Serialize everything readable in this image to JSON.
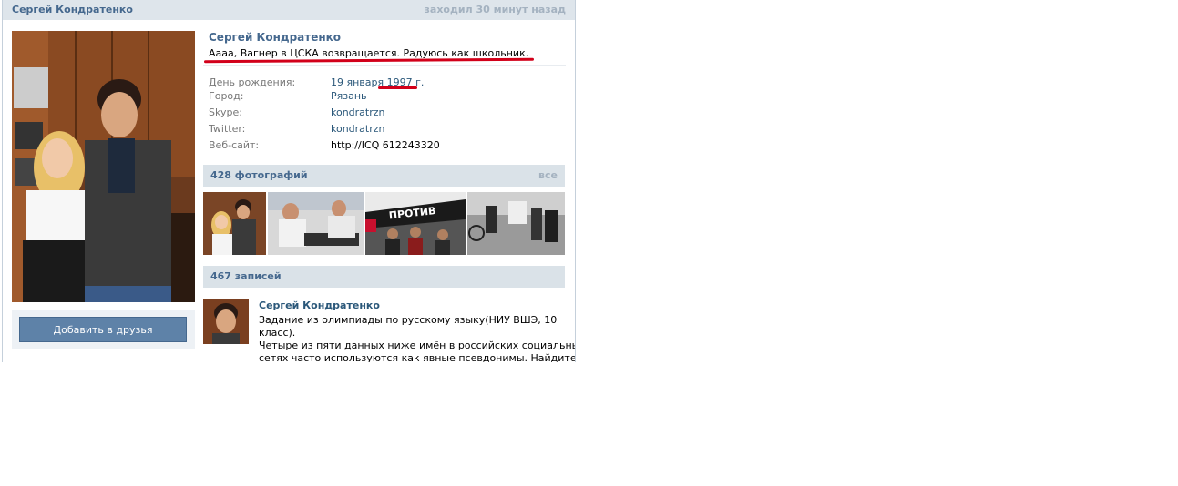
{
  "header": {
    "name": "Сергей Кондратенко",
    "last_seen": "заходил 30 минут назад"
  },
  "profile": {
    "name": "Сергей Кондратенко",
    "status": "Аааа, Вагнер в ЦСКА возвращается. Радуюсь как школьник.",
    "add_friend_label": "Добавить в друзья",
    "fields": [
      {
        "label": "День рождения:",
        "value": "19 января 1997 г."
      },
      {
        "label": "Город:",
        "value": "Рязань"
      },
      {
        "label": "Skype:",
        "value": "kondratrzn"
      },
      {
        "label": "Twitter:",
        "value": "kondratrzn"
      },
      {
        "label": "Веб-сайт:",
        "value": "http://ICQ 612243320"
      }
    ]
  },
  "photos": {
    "title": "428 фотографий",
    "all_label": "все"
  },
  "wall": {
    "title": "467 записей",
    "post": {
      "author": "Сергей Кондратенко",
      "lines": [
        "Задание из олимпиады по русскому языку(НИУ ВШЭ, 10",
        "класс).",
        "Четыре из пяти данных ниже имён в российских социальных",
        "сетях часто используются как явные псевдонимы. Найдите"
      ]
    }
  },
  "photo_labels": {
    "protest_sign": "ПРОТИВ"
  },
  "colors": {
    "link": "#2b587a",
    "header_bg": "#dee5eb",
    "section_bg": "#dae2e8",
    "button": "#5e82a8",
    "annotation": "#d2001a"
  }
}
